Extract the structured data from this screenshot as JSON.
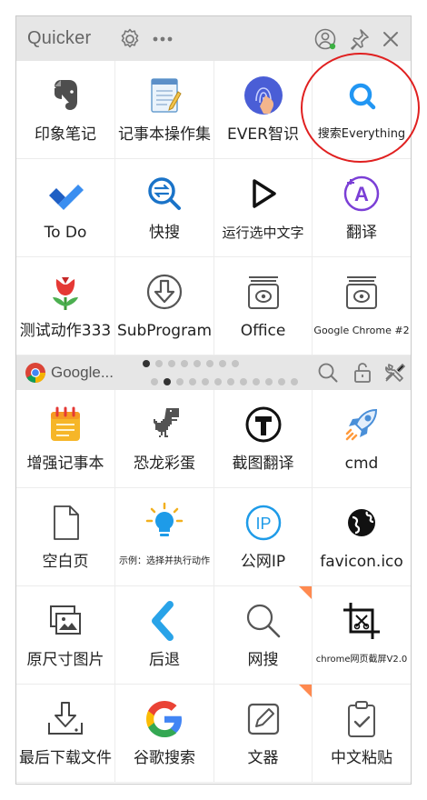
{
  "window": {
    "title": "Quicker",
    "icons": [
      "settings-icon",
      "more-icon",
      "user-icon",
      "pin-icon",
      "close-icon"
    ]
  },
  "top_grid": [
    {
      "label": "印象笔记",
      "icon": "evernote-icon"
    },
    {
      "label": "记事本操作集",
      "icon": "notepad-icon"
    },
    {
      "label": "EVER智识",
      "icon": "fingerprint-icon"
    },
    {
      "label": "搜索Everything",
      "icon": "everything-search-icon"
    },
    {
      "label": "To Do",
      "icon": "todo-check-icon"
    },
    {
      "label": "快搜",
      "icon": "quick-search-icon"
    },
    {
      "label": "运行选中文字",
      "icon": "play-icon"
    },
    {
      "label": "翻译",
      "icon": "translate-icon"
    },
    {
      "label": "测试动作333",
      "icon": "tulip-icon"
    },
    {
      "label": "SubProgram",
      "icon": "download-circle-icon"
    },
    {
      "label": "Office",
      "icon": "office-box-icon"
    },
    {
      "label": "Google Chrome #2",
      "icon": "chrome-box-icon"
    }
  ],
  "context_bar": {
    "title": "Google...",
    "icons": [
      "chrome-icon",
      "search-icon",
      "lock-icon",
      "tools-icon"
    ],
    "pages_row1": {
      "count": 8,
      "active": 0
    },
    "pages_row2": {
      "count": 12,
      "active": 1
    }
  },
  "bottom_grid": [
    {
      "label": "增强记事本",
      "icon": "notepad-plus-icon"
    },
    {
      "label": "恐龙彩蛋",
      "icon": "dino-icon"
    },
    {
      "label": "截图翻译",
      "icon": "screenshot-translate-icon"
    },
    {
      "label": "cmd",
      "icon": "rocket-icon"
    },
    {
      "label": "空白页",
      "icon": "blank-page-icon"
    },
    {
      "label": "示例：选择并执行动作",
      "icon": "bulb-icon"
    },
    {
      "label": "公网IP",
      "icon": "ip-icon"
    },
    {
      "label": "favicon.ico",
      "icon": "globe-icon"
    },
    {
      "label": "原尺寸图片",
      "icon": "images-icon"
    },
    {
      "label": "后退",
      "icon": "back-icon"
    },
    {
      "label": "网搜",
      "icon": "web-search-icon",
      "badge": true
    },
    {
      "label": "chrome网页截屏V2.0",
      "icon": "crop-icon"
    },
    {
      "label": "最后下载文件",
      "icon": "download-tray-icon"
    },
    {
      "label": "谷歌搜索",
      "icon": "google-icon"
    },
    {
      "label": "文器",
      "icon": "edit-icon",
      "badge": true
    },
    {
      "label": "中文粘贴",
      "icon": "clipboard-check-icon"
    }
  ],
  "colors": {
    "highlight": "#e02020",
    "badge": "#ff8a50",
    "bar": "#e6e6e6"
  }
}
